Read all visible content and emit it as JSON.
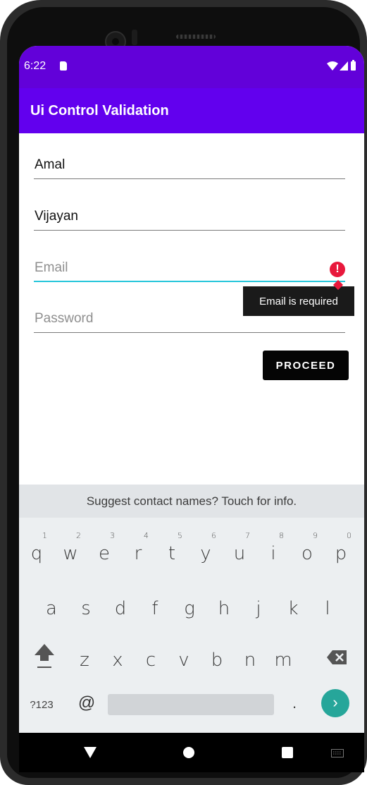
{
  "status_bar": {
    "time": "6:22"
  },
  "app_bar": {
    "title": "Ui Control Validation"
  },
  "form": {
    "first_name": {
      "value": "Amal"
    },
    "last_name": {
      "value": "Vijayan"
    },
    "email": {
      "value": "",
      "placeholder": "Email",
      "error": "Email is required"
    },
    "password": {
      "value": "",
      "placeholder": "Password"
    },
    "proceed_label": "PROCEED"
  },
  "keyboard": {
    "suggestion": "Suggest contact names? Touch for info.",
    "row1": [
      {
        "key": "q",
        "sup": "1"
      },
      {
        "key": "w",
        "sup": "2"
      },
      {
        "key": "e",
        "sup": "3"
      },
      {
        "key": "r",
        "sup": "4"
      },
      {
        "key": "t",
        "sup": "5"
      },
      {
        "key": "y",
        "sup": "6"
      },
      {
        "key": "u",
        "sup": "7"
      },
      {
        "key": "i",
        "sup": "8"
      },
      {
        "key": "o",
        "sup": "9"
      },
      {
        "key": "p",
        "sup": "0"
      }
    ],
    "row2": [
      "a",
      "s",
      "d",
      "f",
      "g",
      "h",
      "j",
      "k",
      "l"
    ],
    "row3": [
      "z",
      "x",
      "c",
      "v",
      "b",
      "n",
      "m"
    ],
    "symbols_label": "?123",
    "at_label": "@",
    "period_label": ".",
    "enter_glyph": "›"
  },
  "colors": {
    "status_bar": "#6201d9",
    "app_bar": "#6200ee",
    "focus_underline": "#26c6da",
    "error": "#e8183c",
    "enter_key": "#26a69a"
  },
  "icons": {
    "status": [
      "sd-card-icon",
      "wifi-icon",
      "signal-icon",
      "battery-icon"
    ],
    "error": "error-icon",
    "nav": [
      "back-icon",
      "home-icon",
      "recents-icon",
      "keyboard-switch-icon"
    ]
  }
}
